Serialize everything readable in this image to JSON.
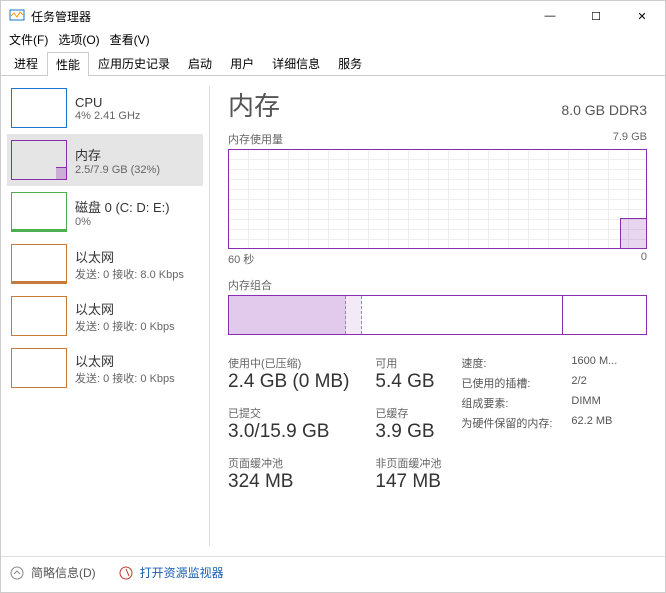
{
  "window": {
    "title": "任务管理器",
    "min": "—",
    "max": "☐",
    "close": "✕"
  },
  "menu": {
    "file": "文件(F)",
    "options": "选项(O)",
    "view": "查看(V)"
  },
  "tabs": {
    "processes": "进程",
    "performance": "性能",
    "history": "应用历史记录",
    "startup": "启动",
    "users": "用户",
    "details": "详细信息",
    "services": "服务"
  },
  "sidebar": {
    "cpu": {
      "name": "CPU",
      "sub": "4% 2.41 GHz"
    },
    "mem": {
      "name": "内存",
      "sub": "2.5/7.9 GB (32%)"
    },
    "disk": {
      "name": "磁盘 0 (C: D: E:)",
      "sub": "0%"
    },
    "eth1": {
      "name": "以太网",
      "sub": "发送: 0 接收: 8.0 Kbps"
    },
    "eth2": {
      "name": "以太网",
      "sub": "发送: 0 接收: 0 Kbps"
    },
    "eth3": {
      "name": "以太网",
      "sub": "发送: 0 接收: 0 Kbps"
    }
  },
  "detail": {
    "title": "内存",
    "capacity": "8.0 GB DDR3",
    "usage_label": "内存使用量",
    "usage_max": "7.9 GB",
    "axis_left": "60 秒",
    "axis_right": "0",
    "composition_label": "内存组合"
  },
  "stats": {
    "inuse_label": "使用中(已压缩)",
    "inuse_value": "2.4 GB (0 MB)",
    "avail_label": "可用",
    "avail_value": "5.4 GB",
    "commit_label": "已提交",
    "commit_value": "3.0/15.9 GB",
    "cached_label": "已缓存",
    "cached_value": "3.9 GB",
    "paged_label": "页面缓冲池",
    "paged_value": "324 MB",
    "nonpaged_label": "非页面缓冲池",
    "nonpaged_value": "147 MB"
  },
  "specs": {
    "speed_label": "速度:",
    "speed_value": "1600 M...",
    "slots_label": "已使用的插槽:",
    "slots_value": "2/2",
    "form_label": "组成要素:",
    "form_value": "DIMM",
    "reserved_label": "为硬件保留的内存:",
    "reserved_value": "62.2 MB"
  },
  "footer": {
    "less": "简略信息(D)",
    "resmon": "打开资源监视器"
  },
  "chart_data": {
    "type": "line",
    "title": "内存使用量",
    "xlabel": "60 秒",
    "ylabel": "GB",
    "ylim": [
      0,
      7.9
    ],
    "x_range_seconds": [
      60,
      0
    ],
    "series": [
      {
        "name": "内存使用量",
        "values_approx": "平直于 ~0.1 GB，最右端升至 ~2.5 GB"
      }
    ],
    "composition_bar": {
      "type": "stacked-horizontal",
      "segments": [
        {
          "name": "使用中",
          "approx_fraction": 0.28
        },
        {
          "name": "已修改",
          "approx_fraction": 0.04
        },
        {
          "name": "备用",
          "approx_fraction": 0.48
        },
        {
          "name": "可用",
          "approx_fraction": 0.2
        }
      ]
    }
  }
}
